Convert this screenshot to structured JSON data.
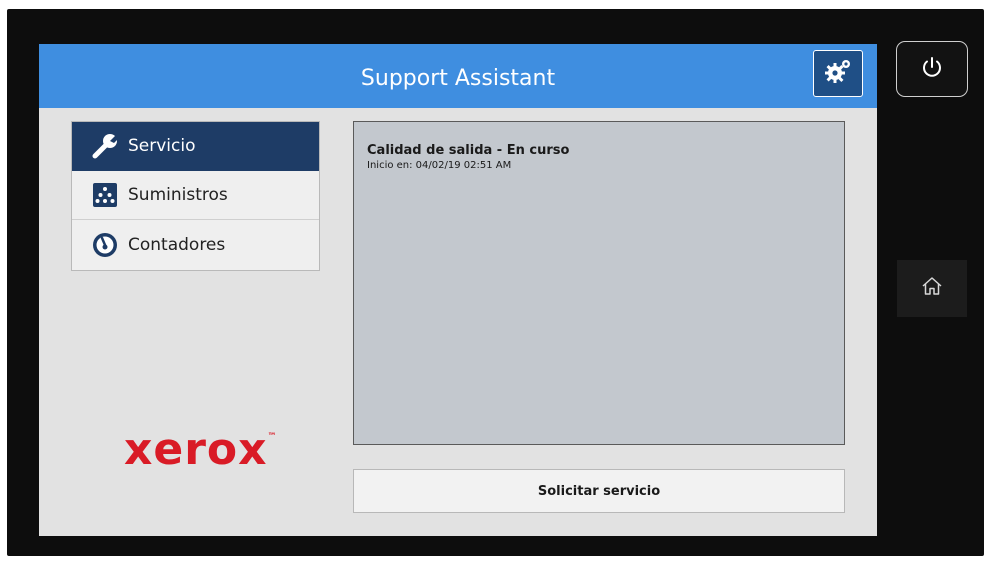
{
  "app": {
    "title": "Support Assistant"
  },
  "header": {
    "settings_icon": "gears-icon"
  },
  "menu": {
    "items": [
      {
        "label": "Servicio",
        "icon": "wrench-icon",
        "active": true
      },
      {
        "label": "Suministros",
        "icon": "supplies-icon",
        "active": false
      },
      {
        "label": "Contadores",
        "icon": "gauge-icon",
        "active": false
      }
    ]
  },
  "status": {
    "title": "Calidad de salida - En curso",
    "subtitle": "Inicio en: 04/02/19 02:51 AM"
  },
  "actions": {
    "request_service": "Solicitar servicio"
  },
  "brand": {
    "logo_text": "xerox",
    "trademark": "™",
    "color": "#d91b26"
  },
  "hardware": {
    "power_icon": "power-icon",
    "home_icon": "home-icon"
  },
  "colors": {
    "titlebar": "#3f8ee0",
    "active_item": "#1e3c66",
    "settings_button": "#1f4f86"
  }
}
